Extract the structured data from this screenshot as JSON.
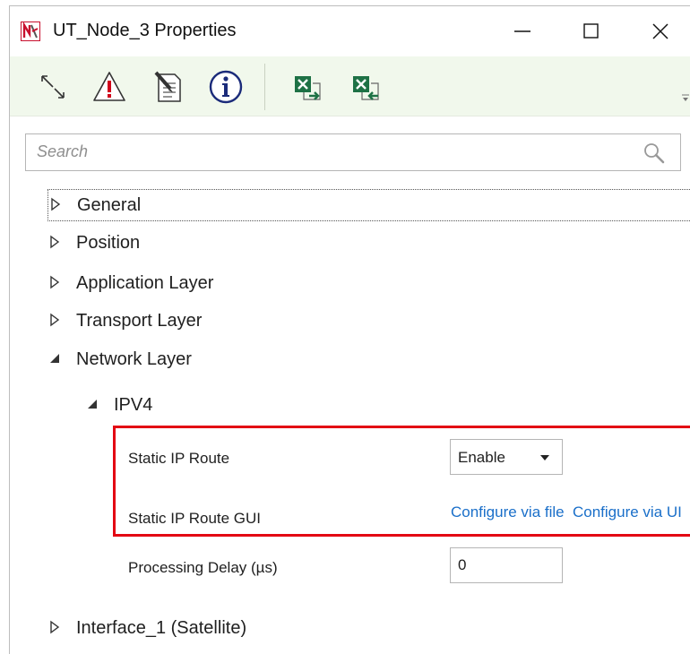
{
  "window": {
    "title": "UT_Node_3 Properties",
    "logo_letter": "N"
  },
  "colors": {
    "toolbar_bg": "#f1f8ec",
    "highlight_border": "#e30613",
    "link": "#1a6fc9",
    "logo_red": "#c8102e"
  },
  "toolbar": {
    "icons": [
      "resize-arrows-icon",
      "warning-icon",
      "edit-document-icon",
      "info-icon",
      "excel-export-icon",
      "excel-import-icon"
    ]
  },
  "search": {
    "placeholder": "Search"
  },
  "tree": {
    "general": "General",
    "position": "Position",
    "application_layer": "Application Layer",
    "transport_layer": "Transport Layer",
    "network_layer": "Network Layer",
    "ipv4": "IPV4",
    "interface_1": "Interface_1 (Satellite)"
  },
  "properties": {
    "static_ip_route": {
      "label": "Static IP Route",
      "value": "Enable"
    },
    "static_ip_route_gui": {
      "label": "Static IP Route GUI",
      "link_file": "Configure via file",
      "link_ui": "Configure via UI"
    },
    "processing_delay": {
      "label": "Processing Delay (µs)",
      "value": "0"
    }
  }
}
